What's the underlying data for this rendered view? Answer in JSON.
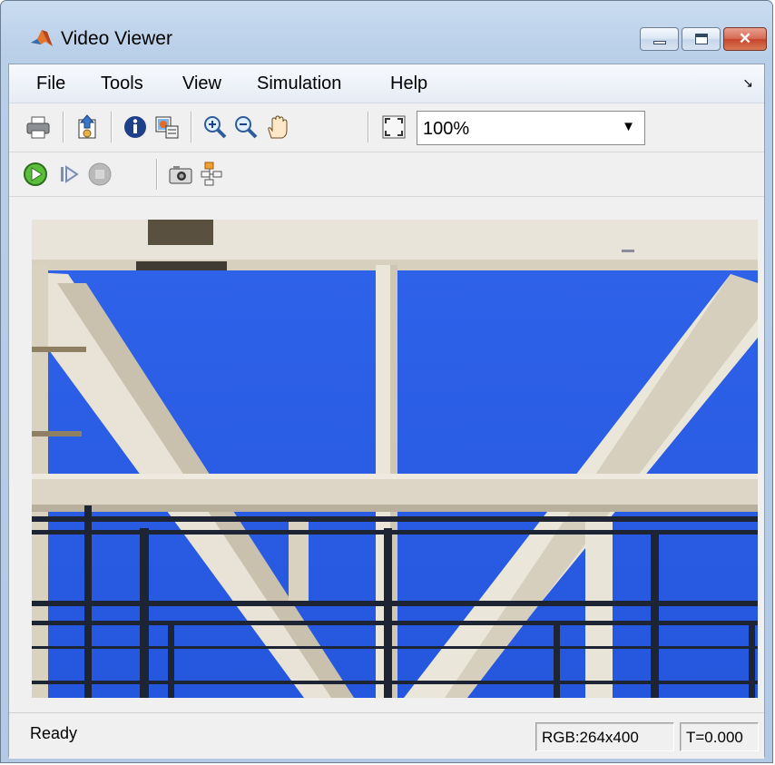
{
  "window": {
    "title": "Video Viewer",
    "close_glyph": "✕"
  },
  "menu": {
    "items": [
      "File",
      "Tools",
      "View",
      "Simulation",
      "Help"
    ],
    "overflow_glyph": "↘"
  },
  "toolbar": {
    "zoom_value": "100%",
    "icons": [
      "print-icon",
      "export-icon",
      "info-icon",
      "image-properties-icon",
      "zoom-in-icon",
      "zoom-out-icon",
      "pan-icon",
      "fit-to-view-icon"
    ]
  },
  "playback": {
    "icons": [
      "run-icon",
      "step-forward-icon",
      "stop-icon",
      "snapshot-icon",
      "highlight-block-icon"
    ]
  },
  "status": {
    "text": "Ready",
    "dimensions": "RGB:264x400",
    "time": "T=0.000"
  },
  "colors": {
    "sky": "#2f5fe6",
    "steel": "#e9e3d3"
  }
}
